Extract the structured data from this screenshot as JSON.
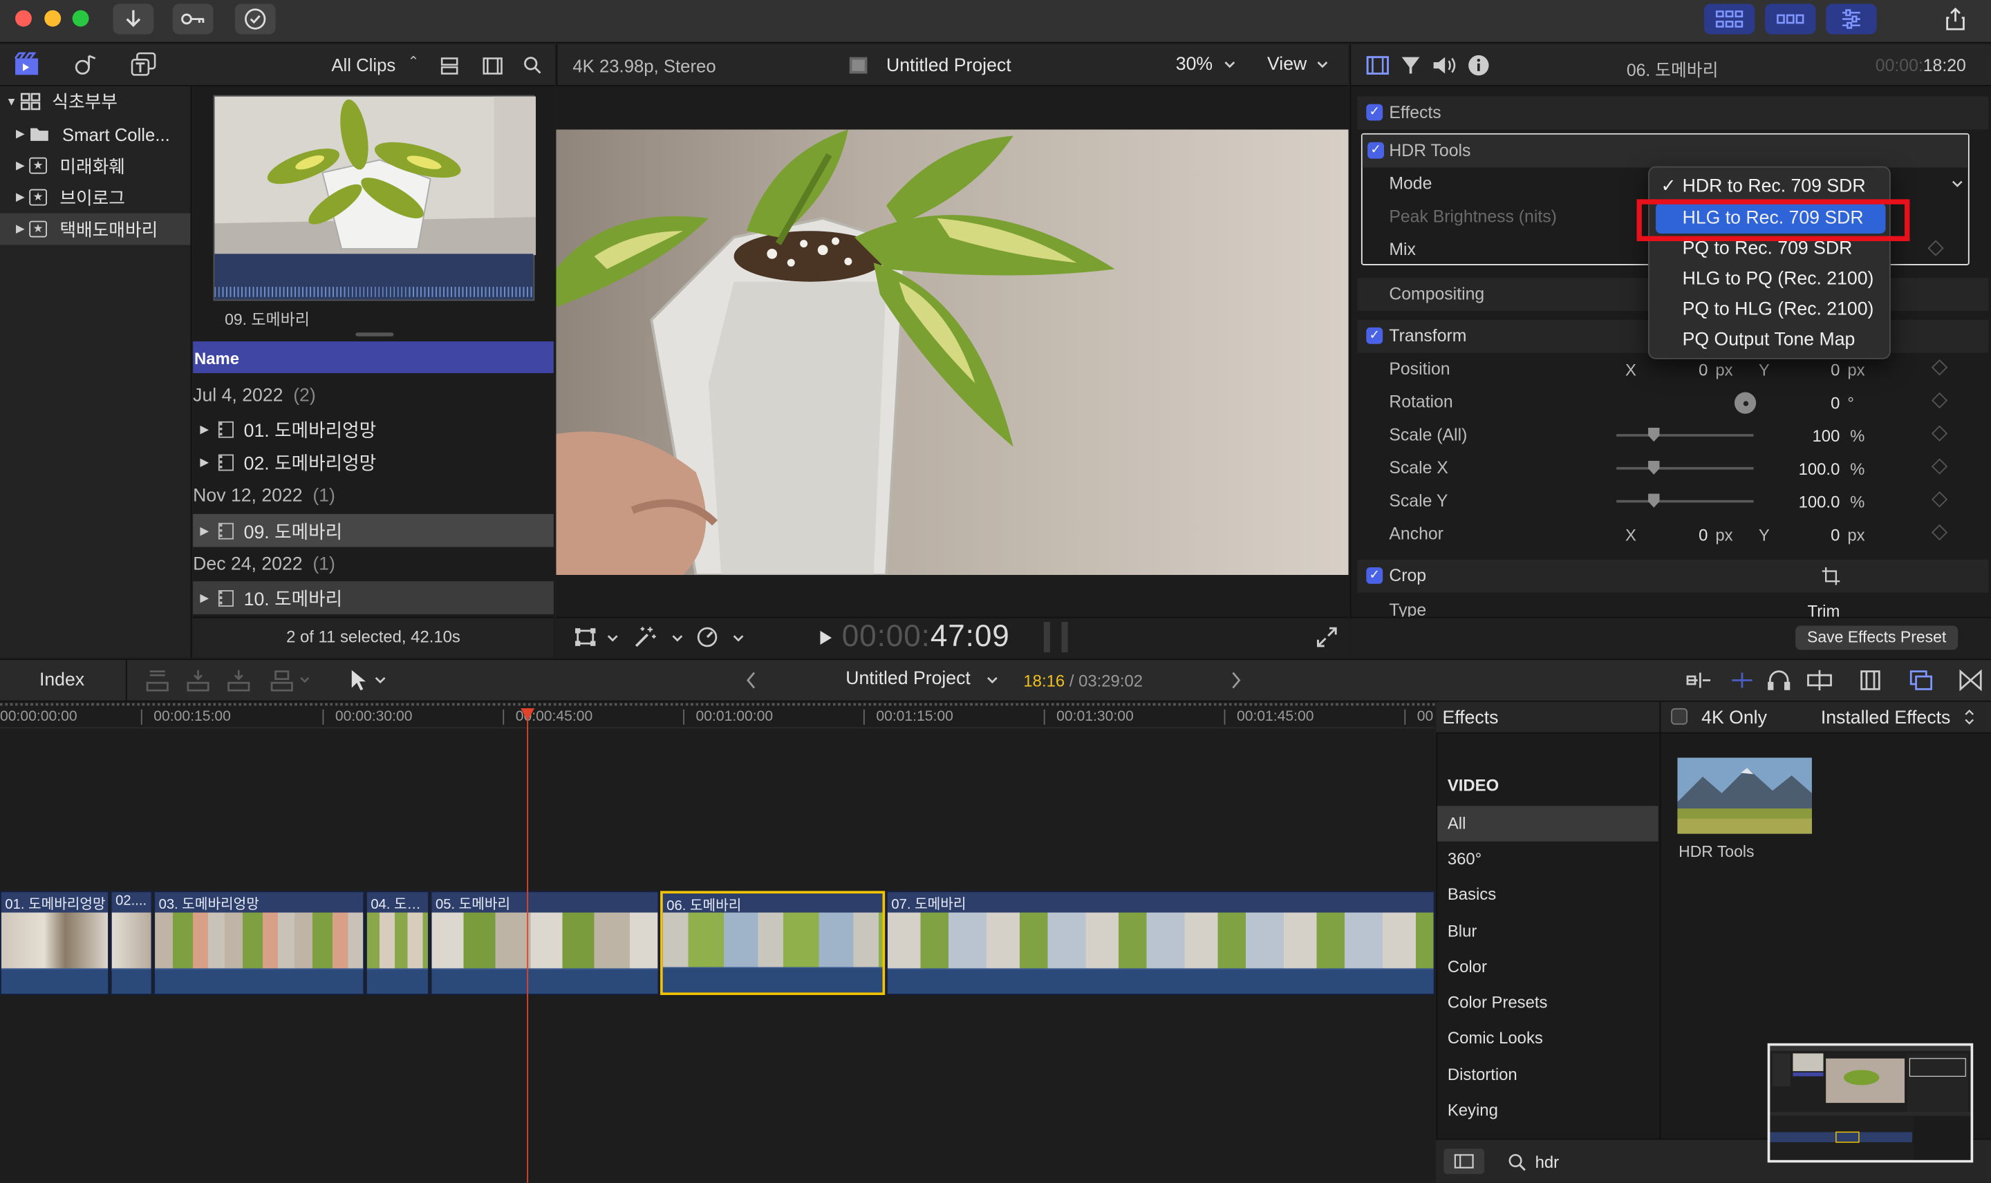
{
  "toolbar": {
    "import_icon": "download-arrow-icon",
    "keywords_icon": "key-icon",
    "check_icon": "checkmark-circle-icon",
    "right_buttons": [
      "grid-view-icon",
      "timeline-layout-icon",
      "inspector-toggle-icon"
    ],
    "share_icon": "share-icon"
  },
  "library": {
    "root": "식초부부",
    "items": [
      {
        "label": "Smart Colle...",
        "icon": "folder-icon"
      },
      {
        "label": "미래화훼",
        "icon": "star-event-icon"
      },
      {
        "label": "브이로그",
        "icon": "star-event-icon"
      },
      {
        "label": "택배도매바리",
        "icon": "star-event-icon"
      }
    ]
  },
  "browser": {
    "filter_label": "All Clips",
    "thumb_caption": "09. 도메바리",
    "column_header": "Name",
    "groups": [
      {
        "date": "Jul 4, 2022",
        "count": "(2)",
        "clips": [
          "01. 도메바리엉망",
          "02. 도메바리엉망"
        ]
      },
      {
        "date": "Nov 12, 2022",
        "count": "(1)",
        "clips": [
          "09. 도메바리"
        ]
      },
      {
        "date": "Dec 24, 2022",
        "count": "(1)",
        "clips": [
          "10. 도메바리"
        ]
      }
    ],
    "status": "2 of 11 selected, 42.10s"
  },
  "viewer": {
    "format": "4K 23.98p, Stereo",
    "project": "Untitled Project",
    "zoom": "30%",
    "view_label": "View",
    "timecode_dim": "00:00:",
    "timecode": "47:09"
  },
  "inspector": {
    "clip_name": "06. 도메바리",
    "duration_dim": "00:00:",
    "duration": "18:20",
    "effects_label": "Effects",
    "hdr": {
      "label": "HDR Tools",
      "mode": "Mode",
      "peak": "Peak Brightness (nits)",
      "mix": "Mix"
    },
    "compositing": "Compositing",
    "transform": {
      "label": "Transform",
      "position": {
        "label": "Position",
        "x_label": "X",
        "x": "0",
        "x_unit": "px",
        "y_label": "Y",
        "y": "0",
        "y_unit": "px"
      },
      "rotation": {
        "label": "Rotation",
        "value": "0",
        "unit": "°"
      },
      "scale_all": {
        "label": "Scale (All)",
        "value": "100",
        "unit": "%"
      },
      "scale_x": {
        "label": "Scale X",
        "value": "100.0",
        "unit": "%"
      },
      "scale_y": {
        "label": "Scale Y",
        "value": "100.0",
        "unit": "%"
      },
      "anchor": {
        "label": "Anchor",
        "x_label": "X",
        "x": "0",
        "x_unit": "px",
        "y_label": "Y",
        "y": "0",
        "y_unit": "px"
      }
    },
    "crop": {
      "label": "Crop",
      "type_label": "Type",
      "type_value": "Trim"
    },
    "save_preset": "Save Effects Preset",
    "mode_menu": {
      "checkmark": "✓",
      "options": [
        "HDR to Rec. 709 SDR",
        "HLG to Rec. 709 SDR",
        "PQ to Rec. 709 SDR",
        "HLG to PQ (Rec. 2100)",
        "PQ to HLG (Rec. 2100)",
        "PQ Output Tone Map"
      ],
      "checked": "HDR to Rec. 709 SDR",
      "highlighted": "HLG to Rec. 709 SDR"
    },
    "highlight_color": "#e8101a"
  },
  "timeline_bar": {
    "index": "Index",
    "project": "Untitled Project",
    "position": "18:16",
    "total": "/ 03:29:02"
  },
  "ruler": [
    "00:00:00:00",
    "00:00:15:00",
    "00:00:30:00",
    "00:00:45:00",
    "00:01:00:00",
    "00:01:15:00",
    "00:01:30:00",
    "00:01:45:00",
    "00"
  ],
  "clips": [
    "01. 도메바리엉망",
    "02....",
    "03. 도메바리엉망",
    "04. 도…",
    "05. 도메바리",
    "06. 도메바리",
    "07. 도메바리"
  ],
  "effects_browser": {
    "title": "Effects",
    "four_k_only": "4K Only",
    "installed": "Installed Effects",
    "section": "VIDEO",
    "categories": [
      "All",
      "360°",
      "Basics",
      "Blur",
      "Color",
      "Color Presets",
      "Comic Looks",
      "Distortion",
      "Keying"
    ],
    "selected_category": "All",
    "result": "HDR Tools",
    "search_value": "hdr"
  }
}
